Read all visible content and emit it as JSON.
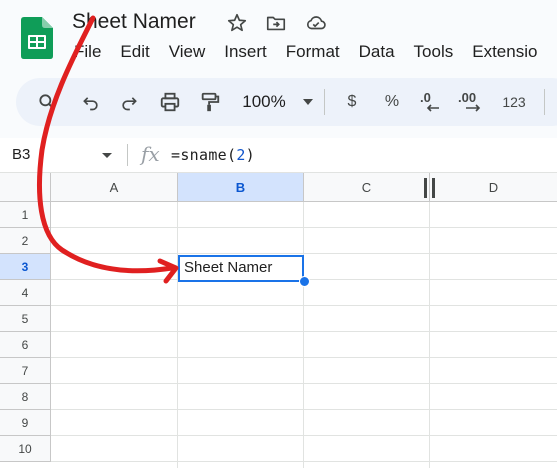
{
  "app": {
    "doc_title": "Sheet Namer",
    "logo": "google-sheets-logo"
  },
  "menu": [
    "File",
    "Edit",
    "View",
    "Insert",
    "Format",
    "Data",
    "Tools",
    "Extensio"
  ],
  "toolbar": {
    "zoom": "100%",
    "currency": "$",
    "percent": "%",
    "dec_decrease": ".0",
    "dec_increase": ".00",
    "number_format": "123"
  },
  "formula_bar": {
    "name_box": "B3",
    "fx": "fx",
    "formula_prefix": "=sname(",
    "formula_arg": "2",
    "formula_suffix": ")"
  },
  "grid": {
    "columns": [
      "A",
      "B",
      "C",
      "D"
    ],
    "rows": [
      "1",
      "2",
      "3",
      "4",
      "5",
      "6",
      "7",
      "8",
      "9",
      "10"
    ],
    "selected_cell_value": "Sheet Namer"
  },
  "colors": {
    "accent": "#1a73e8",
    "selection_header": "#d3e3fd",
    "annotation_arrow": "#e02020",
    "sheets_green": "#0f9d58"
  }
}
